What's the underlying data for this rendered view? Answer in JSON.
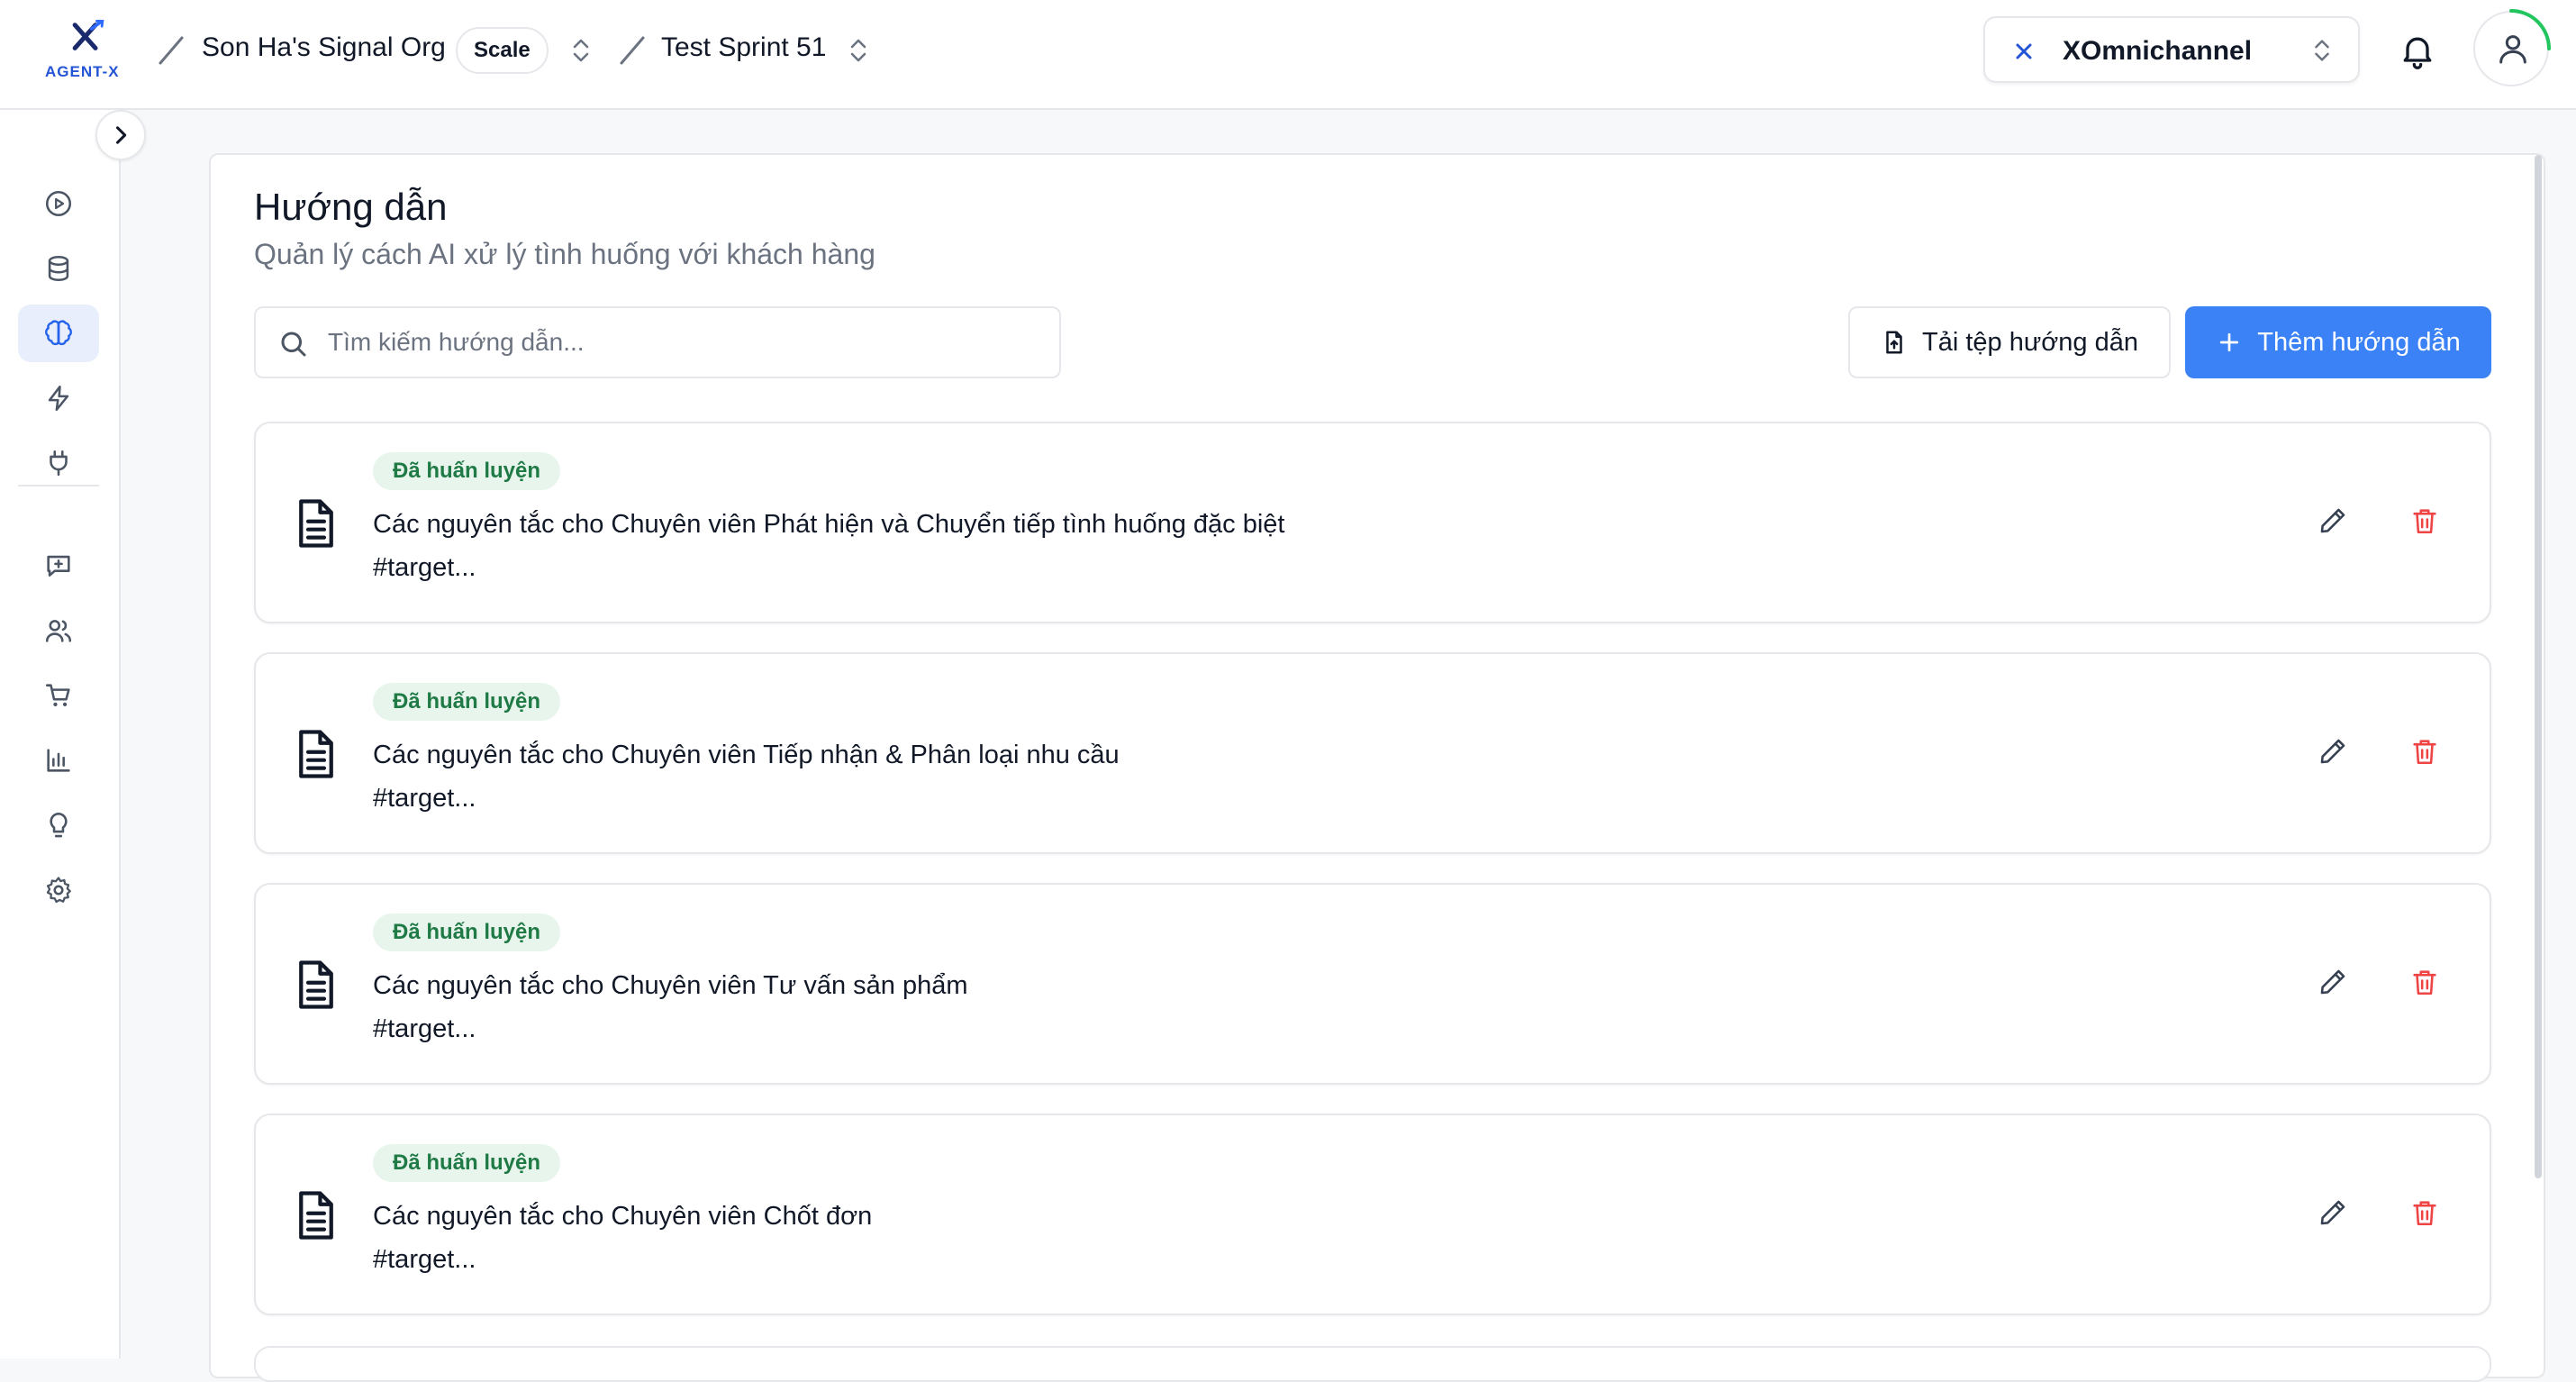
{
  "header": {
    "logo_text": "AGENT-X",
    "org_name": "Son Ha's Signal Org",
    "plan_badge": "Scale",
    "project_name": "Test Sprint 51",
    "workspace": "XOmnichannel"
  },
  "sidebar": {
    "items": [
      {
        "name": "play",
        "icon": "play-circle-icon",
        "active": false
      },
      {
        "name": "database",
        "icon": "database-icon",
        "active": false
      },
      {
        "name": "brain",
        "icon": "brain-icon",
        "active": true
      },
      {
        "name": "automation",
        "icon": "lightning-icon",
        "active": false
      },
      {
        "name": "integrations",
        "icon": "plug-icon",
        "active": false
      },
      {
        "name": "conversations",
        "icon": "message-plus-icon",
        "active": false
      },
      {
        "name": "customers",
        "icon": "users-icon",
        "active": false
      },
      {
        "name": "orders",
        "icon": "cart-icon",
        "active": false
      },
      {
        "name": "analytics",
        "icon": "bar-chart-icon",
        "active": false
      },
      {
        "name": "insights",
        "icon": "lightbulb-icon",
        "active": false
      },
      {
        "name": "settings",
        "icon": "gear-icon",
        "active": false
      }
    ]
  },
  "page": {
    "title": "Hướng dẫn",
    "subtitle": "Quản lý cách AI xử lý tình huống với khách hàng",
    "search_placeholder": "Tìm kiếm hướng dẫn...",
    "upload_label": "Tải tệp hướng dẫn",
    "add_label": "Thêm hướng dẫn"
  },
  "guidelines": [
    {
      "status": "Đã huấn luyện",
      "title": "Các nguyên tắc cho Chuyên viên Phát hiện và Chuyển tiếp tình huống đặc biệt",
      "desc": "#target..."
    },
    {
      "status": "Đã huấn luyện",
      "title": "Các nguyên tắc cho Chuyên viên Tiếp nhận & Phân loại nhu cầu",
      "desc": "#target..."
    },
    {
      "status": "Đã huấn luyện",
      "title": "Các nguyên tắc cho Chuyên viên Tư vấn sản phẩm",
      "desc": "#target..."
    },
    {
      "status": "Đã huấn luyện",
      "title": "Các nguyên tắc cho Chuyên viên Chốt đơn",
      "desc": "#target..."
    }
  ],
  "colors": {
    "accent": "#3b82f6",
    "brand": "#2454d6",
    "badge_bg": "#e7f5ec",
    "badge_text": "#1f7a45",
    "delete": "#ef4444"
  }
}
